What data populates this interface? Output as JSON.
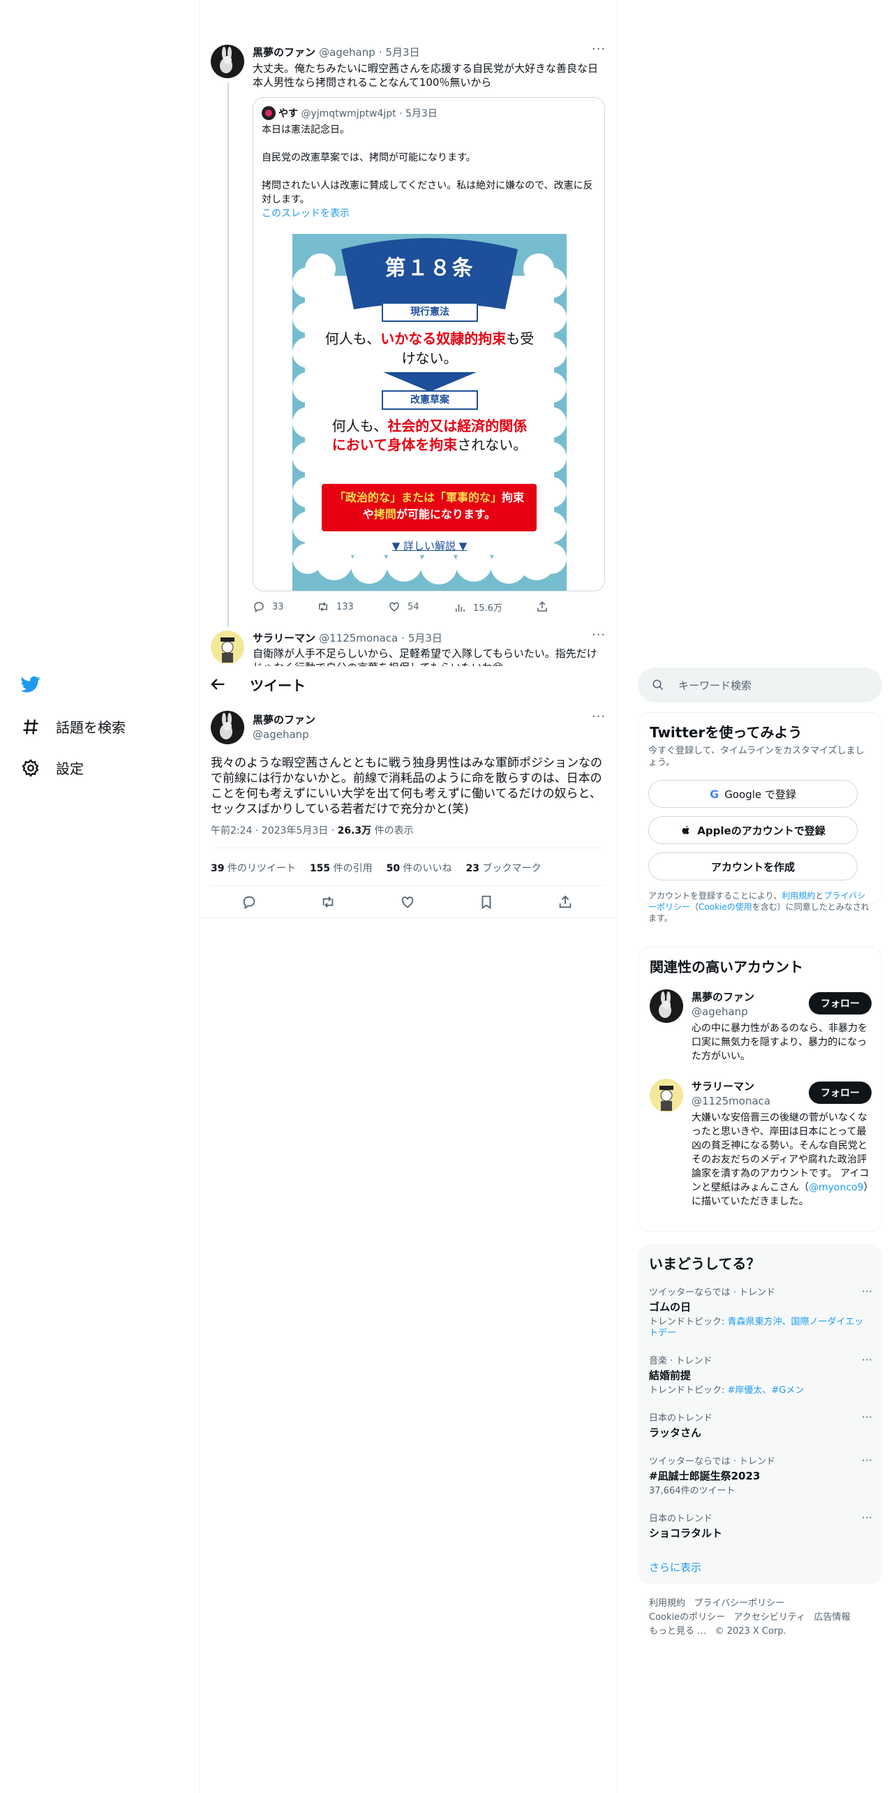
{
  "nav": {
    "explore_label": "話題を検索",
    "settings_label": "設定"
  },
  "prev_tweet": {
    "name": "黒夢のファン",
    "handle": "@agehanp",
    "date": "· 5月3日",
    "text": "大丈夫。俺たちみたいに暇空茜さんを応援する自民党が大好きな善良な日本人男性なら拷問されることなんて100％無いから",
    "quote": {
      "name": "やす",
      "handle": "@yjmqtwmjptw4jpt",
      "date": "· 5月3日",
      "line1": "本日は憲法記念日。",
      "line2": "自民党の改憲草案では、拷問が可能になります。",
      "line3": "拷問されたい人は改憲に賛成してください。私は絶対に嫌なので、改憲に反対します。",
      "thread_link": "このスレッドを表示",
      "image": {
        "title": "第１８条",
        "current_label": "現行憲法",
        "current_pre": "何人も、",
        "current_red": "いかなる奴隷的拘束",
        "current_post": "も受けない。",
        "draft_label": "改憲草案",
        "draft_pre": "何人も、",
        "draft_red": "社会的又は経済的関係において身体を拘束",
        "draft_post": "されない。",
        "warning_yellow1": "「政治的な」または「軍事的な」",
        "warning_white1": "拘束",
        "warning_white2": "や",
        "warning_yellow2": "拷問",
        "warning_white3": "が可能になります。",
        "detail": "▼ 詳しい解説 ▼"
      }
    },
    "replies": "33",
    "retweets": "133",
    "likes": "54",
    "views": "15.6万"
  },
  "reply_tweet": {
    "name": "サラリーマン",
    "handle": "@1125monaca",
    "date": "· 5月3日",
    "text": "自衛隊が人手不足らしいから、足軽希望で入隊してもらいたい。指先だけじゃなく行動で自分の言葉を担保してもらいたいわ😊"
  },
  "header": {
    "title": "ツイート"
  },
  "main_tweet": {
    "name": "黒夢のファン",
    "handle": "@agehanp",
    "text": "我々のような暇空茜さんとともに戦う独身男性はみな軍師ポジションなので前線には行かないかと。前線で消耗品のように命を散らすのは、日本のことを何も考えずにいい大学を出て何も考えずに働いてるだけの奴らと、セックスばかりしている若者だけで充分かと(笑)",
    "time": "午前2:24 · 2023年5月3日 · ",
    "views_bold": "26.3万",
    "views_label": " 件の表示",
    "stats": {
      "retweets_n": "39",
      "retweets_l": " 件のリツイート",
      "quotes_n": "155",
      "quotes_l": " 件の引用",
      "likes_n": "50",
      "likes_l": " 件のいいね",
      "bookmarks_n": "23",
      "bookmarks_l": " ブックマーク"
    }
  },
  "search": {
    "placeholder": "キーワード検索"
  },
  "signup": {
    "title": "Twitterを使ってみよう",
    "subtitle": "今すぐ登録して、タイムラインをカスタマイズしましょう。",
    "google": "Google で登録",
    "apple": "Appleのアカウントで登録",
    "create": "アカウントを作成",
    "legal_1": "アカウントを登録することにより、",
    "legal_link1": "利用規約",
    "legal_2": "と",
    "legal_link2": "プライバシーポリシー",
    "legal_3": "（",
    "legal_link3": "Cookieの使用",
    "legal_4": "を含む）に同意したとみなされます。"
  },
  "related": {
    "title": "関連性の高いアカウント",
    "follow_label": "フォロー",
    "accounts": [
      {
        "name": "黒夢のファン",
        "handle": "@agehanp",
        "bio": "心の中に暴力性があるのなら、非暴力を口実に無気力を隠すより、暴力的になった方がいい。"
      },
      {
        "name": "サラリーマン",
        "handle": "@1125monaca",
        "bio_1": "大嫌いな安倍晋三の後継の菅がいなくなったと思いきや、岸田は日本にとって最凶の貧乏神になる勢い。そんな自民党とそのお友だちのメディアや腐れた政治評論家を潰す為のアカウントです。 アイコンと壁紙はみょんこさん（",
        "bio_link": "@myonco9",
        "bio_2": "）に描いていただきました。"
      }
    ]
  },
  "trends": {
    "title": "いまどうしてる？",
    "items": [
      {
        "category": "ツイッターならでは · トレンド",
        "name": "ゴムの日",
        "sub_label": "トレンドトピック: ",
        "sub_link": "青森県東方沖、国際ノーダイエットデー"
      },
      {
        "category": "音楽 · トレンド",
        "name": "結婚前提",
        "sub_label": "トレンドトピック: ",
        "sub_link": "#岸優太、#Gメン"
      },
      {
        "category": "日本のトレンド",
        "name": "ラッタさん"
      },
      {
        "category": "ツイッターならでは · トレンド",
        "name": "#凪誠士郎誕生祭2023",
        "count": "37,664件のツイート"
      },
      {
        "category": "日本のトレンド",
        "name": "ショコラタルト"
      }
    ],
    "show_more": "さらに表示"
  },
  "footer": {
    "terms": "利用規約",
    "privacy": "プライバシーポリシー",
    "cookie": "Cookieのポリシー",
    "accessibility": "アクセシビリティ",
    "ads": "広告情報",
    "more": "もっと見る …",
    "copyright": "© 2023 X Corp."
  }
}
